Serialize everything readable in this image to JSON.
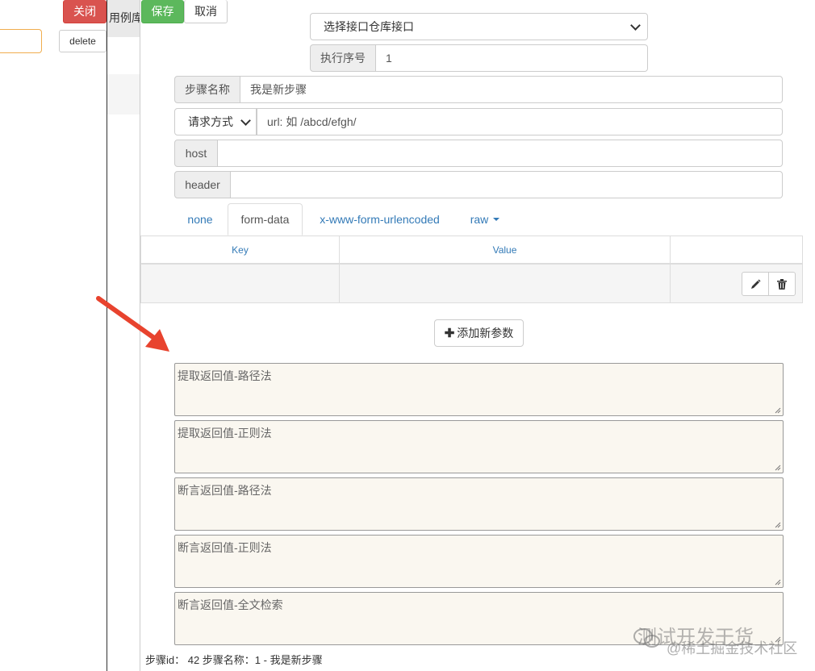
{
  "background": {
    "close_label": "关闭",
    "delete_label": "delete",
    "tab_fragment": "用例库"
  },
  "toolbar": {
    "save_label": "保存",
    "cancel_label": "取消"
  },
  "form": {
    "repo_select_value": "选择接口仓库接口",
    "exec_order_label": "执行序号",
    "exec_order_value": "1",
    "step_name_label": "步骤名称",
    "step_name_value": "我是新步骤",
    "method_select_value": "请求方式",
    "url_placeholder": "url: 如 /abcd/efgh/",
    "host_label": "host",
    "host_value": "",
    "header_label": "header",
    "header_value": ""
  },
  "body_tabs": [
    {
      "label": "none"
    },
    {
      "label": "form-data"
    },
    {
      "label": "x-www-form-urlencoded"
    },
    {
      "label": "raw"
    }
  ],
  "params_table": {
    "columns": [
      "Key",
      "Value",
      ""
    ],
    "rows": [
      {
        "key": "",
        "value": ""
      }
    ]
  },
  "add_param_label": "添加新参数",
  "extractors": [
    {
      "placeholder": "提取返回值-路径法"
    },
    {
      "placeholder": "提取返回值-正则法"
    },
    {
      "placeholder": "断言返回值-路径法"
    },
    {
      "placeholder": "断言返回值-正则法"
    },
    {
      "placeholder": "断言返回值-全文检索"
    }
  ],
  "footer_text": "步骤id： 42 步骤名称：1 - 我是新步骤",
  "watermark": {
    "line1": "测试开发干货",
    "line2": "@稀土掘金技术社区"
  },
  "colors": {
    "save": "#5cb85c",
    "close": "#d9534f",
    "link": "#337ab7",
    "arrow": "#e8432e",
    "textarea_bg": "#faf7f0"
  }
}
